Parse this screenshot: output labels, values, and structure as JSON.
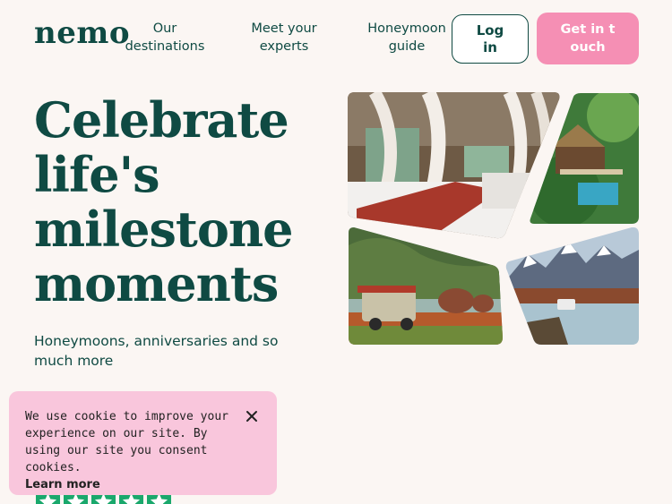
{
  "header": {
    "logo": "nemo",
    "nav": [
      {
        "label": "Our destinations"
      },
      {
        "label": "Meet your experts"
      },
      {
        "label": "Honeymoon guide"
      }
    ],
    "login_label": "Log in",
    "cta_label": "Get in touch"
  },
  "hero": {
    "title": "Celebrate life's milestone moments",
    "subtitle": "Honeymoons, anniversaries and so much more"
  },
  "cookie_banner": {
    "text": "We use cookie to improve your experience on our site. By using our site you consent cookies.",
    "link": "Learn more",
    "close_icon": "close-icon"
  },
  "colors": {
    "brand_green": "#0f4a43",
    "pink": "#f58fb4",
    "cookie_bg": "#f9c6dc",
    "background": "#fbf6f3",
    "rating_green": "#1aa86c"
  },
  "photos": [
    "safari-tent-bedroom",
    "treehouse-pool-villa",
    "elephants-safari-jeep",
    "mountain-lake-jeep"
  ]
}
